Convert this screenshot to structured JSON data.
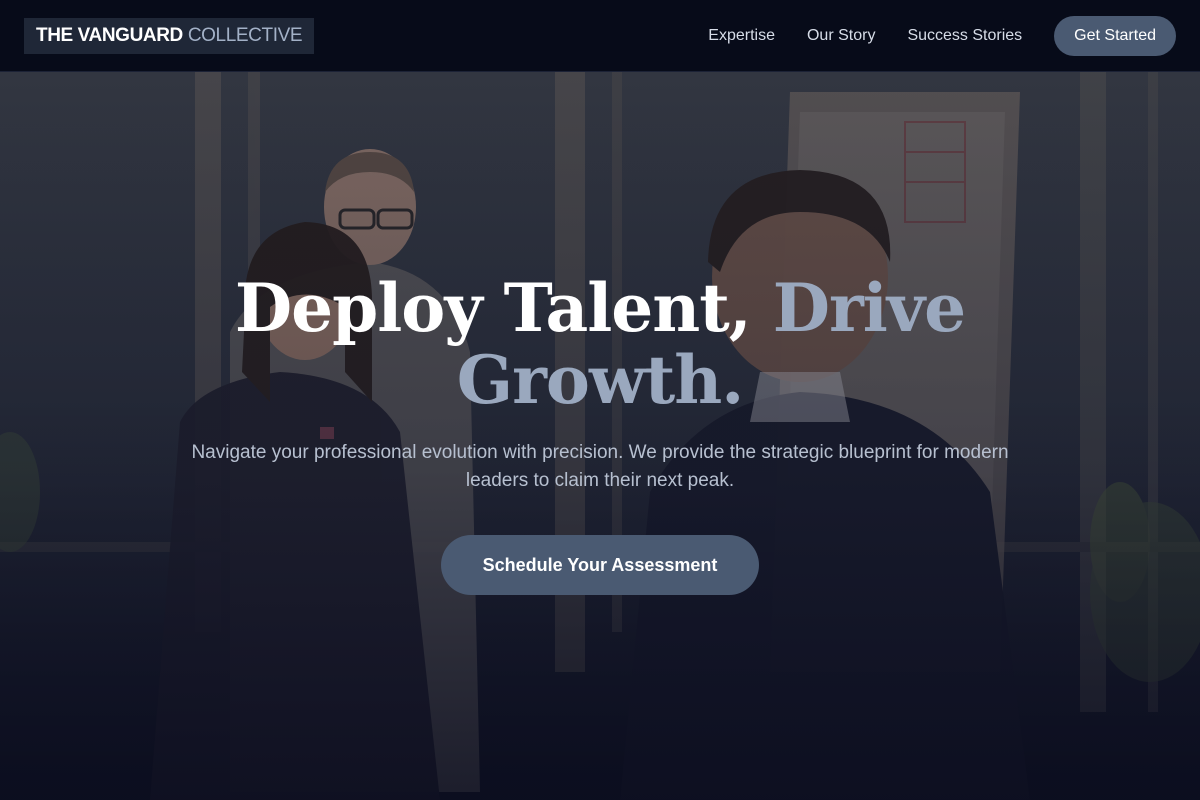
{
  "brand": {
    "name_primary": "THE VANGUARD",
    "name_secondary": "COLLECTIVE"
  },
  "nav": {
    "links": [
      "Expertise",
      "Our Story",
      "Success Stories"
    ],
    "cta_label": "Get Started"
  },
  "hero": {
    "headline_part1": "Deploy Talent,",
    "headline_part2": "Drive Growth.",
    "subtitle": "Navigate your professional evolution with precision. We provide the strategic blueprint for modern leaders to claim their next peak.",
    "cta_label": "Schedule Your Assessment",
    "background_photo": "office-team-meeting-photo"
  },
  "colors": {
    "nav_bg": "#070b19",
    "accent_button": "#4a5a72",
    "accent_text": "#9aa8be",
    "body_text": "#b7c0d0"
  }
}
